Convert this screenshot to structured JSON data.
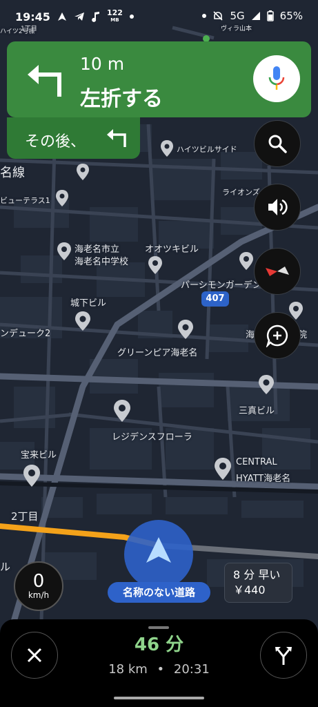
{
  "status_bar": {
    "time": "19:45",
    "data_rate_value": "122",
    "data_rate_unit": "MB",
    "network": "5G",
    "battery": "65%"
  },
  "navigation": {
    "distance": "10 m",
    "instruction": "左折する",
    "then_label": "その後、"
  },
  "map_labels": {
    "top_street": "ハイツ2号棟",
    "top_block": "1丁目",
    "top_building": "ヴィラ山本",
    "haitsu": "ハイツビルサイド",
    "line_name": "名線",
    "view_terrace": "ビューテラス1",
    "lions": "ライオンズ",
    "ebina_school_1": "海老名市立",
    "ebina_school_2": "海老名中学校",
    "otsuki": "オオツキビル",
    "persimmon": "パーシモンガーデン",
    "route_number": "407",
    "shiroshita": "城下ビル",
    "ndyuku": "ンデューク2",
    "umi": "海",
    "in": "院",
    "green_pia": "グリーンピア海老名",
    "sanshin": "三真ビル",
    "residence": "レジデンスフローラ",
    "horai": "宝来ビル",
    "central_1": "CENTRAL",
    "central_2": "HYATT海老名",
    "nichome": "2丁目",
    "left_edge": "ル"
  },
  "speed": {
    "value": "0",
    "unit": "km/h"
  },
  "current_road": "名称のない道路",
  "alternate_route": {
    "line1": "8 分 早い",
    "line2": "￥440"
  },
  "trip": {
    "minutes": "46 分",
    "distance": "18 km",
    "separator": "•",
    "arrival": "20:31"
  },
  "colors": {
    "nav_green": "#3a8a3f",
    "route_orange": "#f4a21a",
    "position_blue": "#2e62c9",
    "eta_green": "#8fd48b"
  },
  "icons": {
    "status": [
      "navigation-arrow-icon",
      "telegram-icon",
      "music-note-icon",
      "dot-icon",
      "dnd-off-icon",
      "signal-icon",
      "battery-icon"
    ],
    "nav_turn": "turn-left-icon",
    "voice": "mic-icon",
    "fabs": [
      "search-icon",
      "sound-icon",
      "compass-icon",
      "add-report-icon"
    ],
    "bottom": [
      "close-icon",
      "alternate-routes-icon"
    ]
  }
}
